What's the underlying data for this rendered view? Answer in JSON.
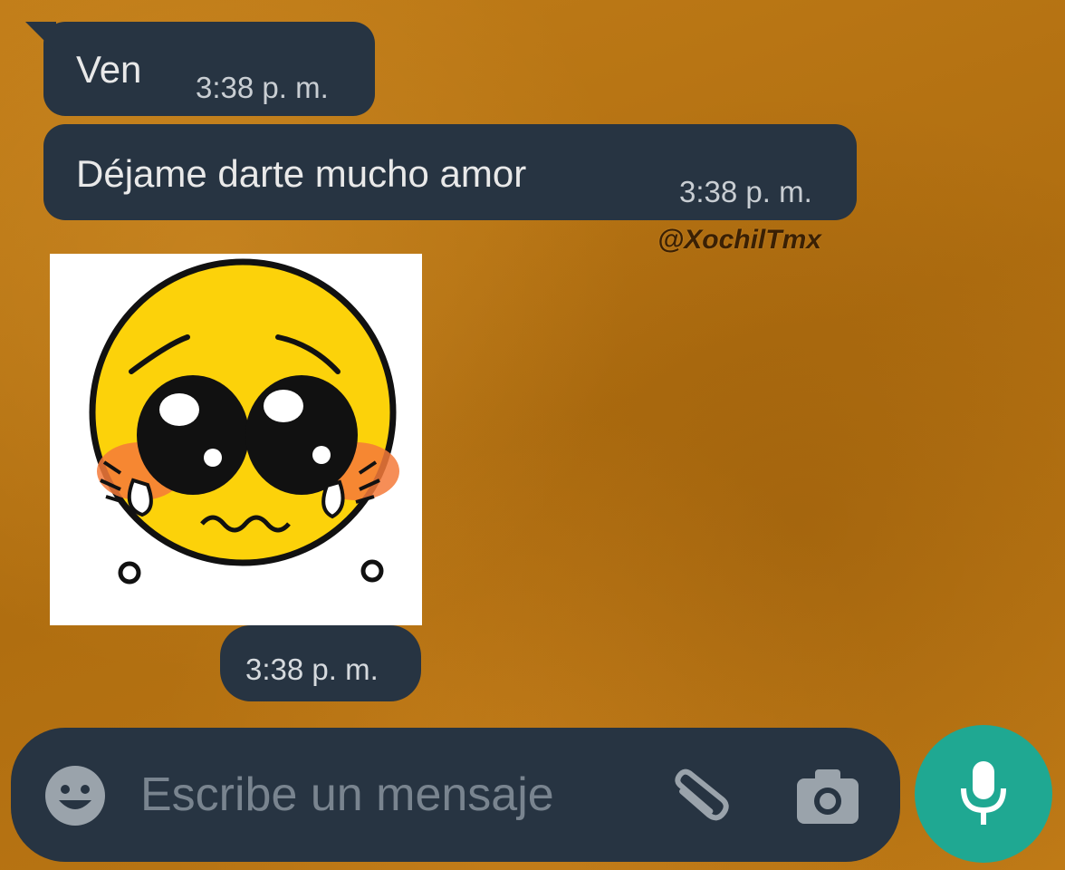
{
  "messages": [
    {
      "text": "Ven",
      "time": "3:38 p. m."
    },
    {
      "text": "Déjame darte mucho amor",
      "time": "3:38 p. m."
    },
    {
      "type": "sticker",
      "sticker_icon": "pleading-face-sticker",
      "time": "3:38 p. m."
    }
  ],
  "watermark": "@XochilTmx",
  "composer": {
    "placeholder": "Escribe un mensaje",
    "emoji_icon": "emoji-icon",
    "attach_icon": "paperclip-icon",
    "camera_icon": "camera-icon",
    "send_icon": "microphone-icon"
  },
  "colors": {
    "wallpaper": "#b87414",
    "bubble": "#273442",
    "mic_button": "#1fa892"
  }
}
